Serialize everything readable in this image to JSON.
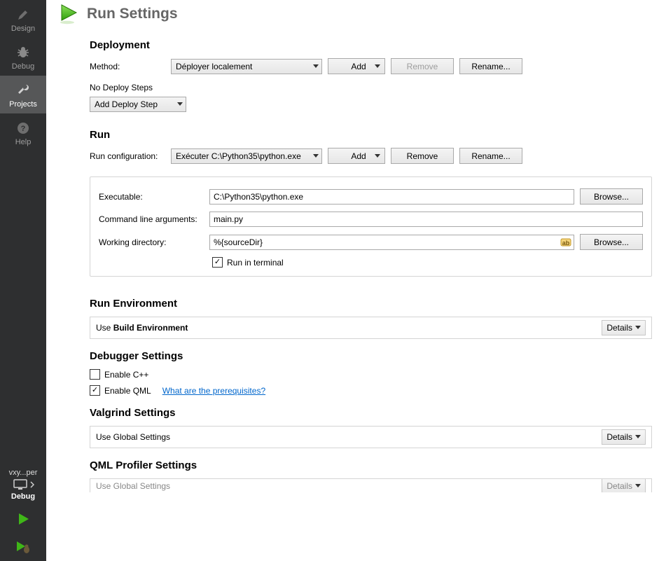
{
  "sidebar": {
    "items": [
      {
        "label": "Design"
      },
      {
        "label": "Debug"
      },
      {
        "label": "Projects"
      },
      {
        "label": "Help"
      }
    ],
    "target": {
      "name": "vxy...per",
      "config": "Debug"
    }
  },
  "page": {
    "title": "Run Settings"
  },
  "deployment": {
    "title": "Deployment",
    "method_label": "Method:",
    "method_value": "Déployer localement",
    "add": "Add",
    "remove": "Remove",
    "rename": "Rename...",
    "no_steps": "No Deploy Steps",
    "add_step": "Add Deploy Step"
  },
  "run": {
    "title": "Run",
    "config_label": "Run configuration:",
    "config_value": "Exécuter C:\\Python35\\python.exe",
    "add": "Add",
    "remove": "Remove",
    "rename": "Rename...",
    "exe_label": "Executable:",
    "exe_value": "C:\\Python35\\python.exe",
    "args_label": "Command line arguments:",
    "args_value": "main.py",
    "wd_label": "Working directory:",
    "wd_value": "%{sourceDir}",
    "run_terminal": "Run in terminal",
    "browse": "Browse..."
  },
  "run_env": {
    "title": "Run Environment",
    "use": "Use ",
    "value": "Build Environment",
    "details": "Details"
  },
  "debugger": {
    "title": "Debugger Settings",
    "cpp": "Enable C++",
    "qml": "Enable QML",
    "prereq": "What are the prerequisites?"
  },
  "valgrind": {
    "title": "Valgrind Settings",
    "value": "Use Global Settings",
    "details": "Details"
  },
  "qmlprof": {
    "title": "QML Profiler Settings",
    "value": "Use Global Settings",
    "details": "Details"
  }
}
